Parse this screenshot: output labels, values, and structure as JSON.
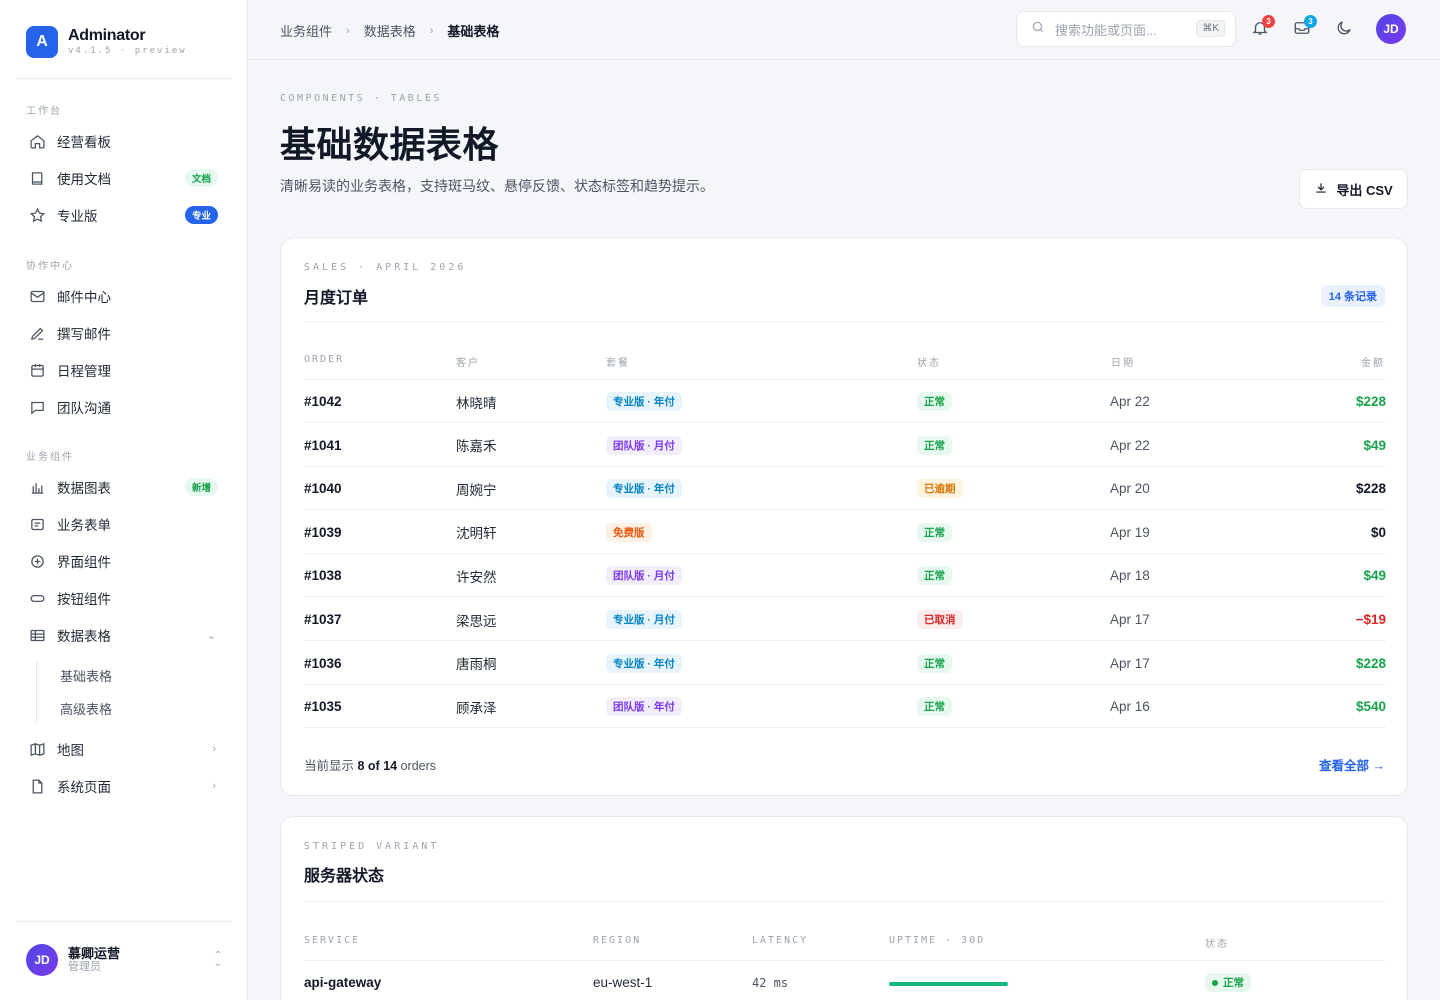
{
  "brand": {
    "logo_letter": "A",
    "name": "Adminator",
    "version": "v4.1.5 · preview"
  },
  "sidebar": {
    "sections": [
      "工作台",
      "协作中心",
      "业务组件"
    ],
    "items": [
      {
        "label": "经营看板",
        "icon": "home-icon"
      },
      {
        "label": "使用文档",
        "icon": "book-icon",
        "badge": "文档"
      },
      {
        "label": "专业版",
        "icon": "star-icon",
        "badge": "专业"
      },
      {
        "label": "邮件中心",
        "icon": "mail-icon"
      },
      {
        "label": "撰写邮件",
        "icon": "pen-icon"
      },
      {
        "label": "日程管理",
        "icon": "calendar-icon"
      },
      {
        "label": "团队沟通",
        "icon": "chat-icon"
      },
      {
        "label": "数据图表",
        "icon": "bar-chart-icon",
        "badge": "新增"
      },
      {
        "label": "业务表单",
        "icon": "form-icon"
      },
      {
        "label": "界面组件",
        "icon": "plus-circle-icon"
      },
      {
        "label": "按钮组件",
        "icon": "button-icon"
      },
      {
        "label": "数据表格",
        "icon": "table-icon"
      },
      {
        "label": "地图",
        "icon": "map-icon"
      },
      {
        "label": "系统页面",
        "icon": "file-icon"
      }
    ],
    "sub_items": [
      "基础表格",
      "高级表格"
    ],
    "user": {
      "initials": "JD",
      "name": "慕卿运营",
      "role": "管理员"
    }
  },
  "header": {
    "breadcrumbs": [
      "业务组件",
      "数据表格",
      "基础表格"
    ],
    "search_placeholder": "搜索功能或页面...",
    "search_shortcut": "⌘K",
    "notifications_count": "3",
    "inbox_count": "3",
    "avatar_initials": "JD"
  },
  "page": {
    "eyebrow": "COMPONENTS · TABLES",
    "title": "基础数据表格",
    "subtitle": "清晰易读的业务表格，支持斑马纹、悬停反馈、状态标签和趋势提示。",
    "export_label": "导出 CSV"
  },
  "orders_card": {
    "eyebrow": "SALES · APRIL 2026",
    "title": "月度订单",
    "record_badge": "14 条记录",
    "columns": [
      "ORDER",
      "客户",
      "套餐",
      "状态",
      "日期",
      "金额"
    ],
    "rows": [
      {
        "order": "#1042",
        "customer": "林晓晴",
        "plan": "专业版 · 年付",
        "plan_type": "pro",
        "status": "正常",
        "status_type": "ok",
        "date": "Apr 22",
        "amount": "$228",
        "amount_type": "pos"
      },
      {
        "order": "#1041",
        "customer": "陈嘉禾",
        "plan": "团队版 · 月付",
        "plan_type": "team",
        "status": "正常",
        "status_type": "ok",
        "date": "Apr 22",
        "amount": "$49",
        "amount_type": "pos"
      },
      {
        "order": "#1040",
        "customer": "周婉宁",
        "plan": "专业版 · 年付",
        "plan_type": "pro",
        "status": "已逾期",
        "status_type": "warn",
        "date": "Apr 20",
        "amount": "$228",
        "amount_type": "neutral"
      },
      {
        "order": "#1039",
        "customer": "沈明轩",
        "plan": "免费版",
        "plan_type": "free",
        "status": "正常",
        "status_type": "ok",
        "date": "Apr 19",
        "amount": "$0",
        "amount_type": "neutral"
      },
      {
        "order": "#1038",
        "customer": "许安然",
        "plan": "团队版 · 月付",
        "plan_type": "team",
        "status": "正常",
        "status_type": "ok",
        "date": "Apr 18",
        "amount": "$49",
        "amount_type": "pos"
      },
      {
        "order": "#1037",
        "customer": "梁思远",
        "plan": "专业版 · 月付",
        "plan_type": "pro",
        "status": "已取消",
        "status_type": "cancel",
        "date": "Apr 17",
        "amount": "−$19",
        "amount_type": "neg"
      },
      {
        "order": "#1036",
        "customer": "唐雨桐",
        "plan": "专业版 · 年付",
        "plan_type": "pro",
        "status": "正常",
        "status_type": "ok",
        "date": "Apr 17",
        "amount": "$228",
        "amount_type": "pos"
      },
      {
        "order": "#1035",
        "customer": "顾承泽",
        "plan": "团队版 · 年付",
        "plan_type": "team",
        "status": "正常",
        "status_type": "ok",
        "date": "Apr 16",
        "amount": "$540",
        "amount_type": "pos"
      }
    ],
    "footer_prefix": "当前显示",
    "footer_count": "8 of 14",
    "footer_suffix": "orders",
    "view_all": "查看全部"
  },
  "servers_card": {
    "eyebrow": "STRIPED VARIANT",
    "title": "服务器状态",
    "columns": [
      "SERVICE",
      "REGION",
      "LATENCY",
      "UPTIME · 30D",
      "状态"
    ],
    "rows": [
      {
        "service": "api-gateway",
        "region": "eu-west-1",
        "latency": "42 ms",
        "uptime": 1.0,
        "status": "正常"
      }
    ]
  },
  "colors": {
    "accent": "#2563eb",
    "positive": "#16a34a",
    "negative": "#dc2626",
    "warning": "#d97706"
  }
}
